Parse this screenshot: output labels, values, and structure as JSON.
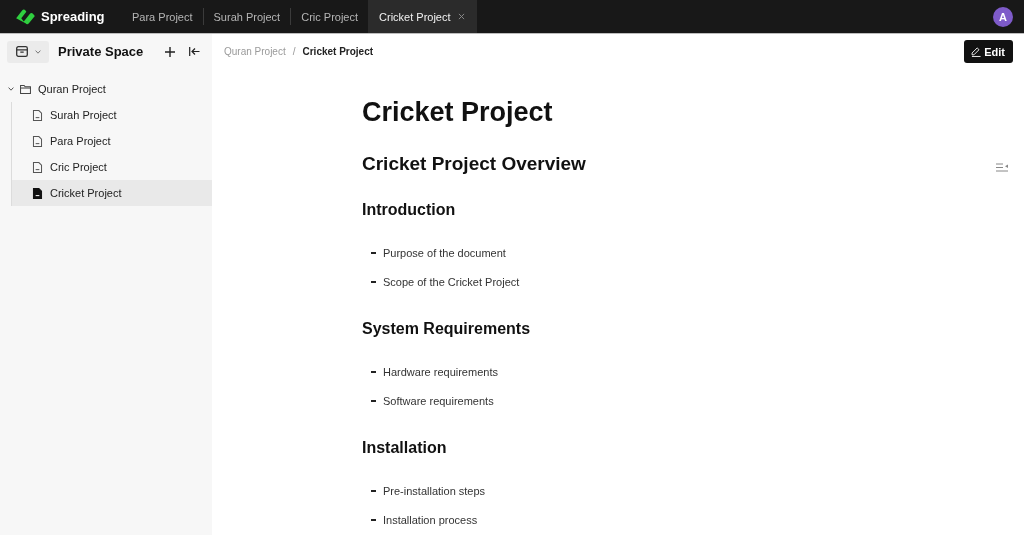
{
  "app_bar": {
    "logo_text": "Spreading",
    "tabs": [
      {
        "label": "Para Project",
        "selected": false
      },
      {
        "label": "Surah Project",
        "selected": false
      },
      {
        "label": "Cric Project",
        "selected": false
      },
      {
        "label": "Cricket Project",
        "selected": true
      }
    ],
    "avatar_initial": "A"
  },
  "sidebar": {
    "title": "Private Space",
    "tree": [
      {
        "label": "Quran Project",
        "kind": "folder",
        "expanded": true,
        "selected": false,
        "children": [
          {
            "label": "Surah Project",
            "kind": "doc",
            "selected": false
          },
          {
            "label": "Para Project",
            "kind": "doc",
            "selected": false
          },
          {
            "label": "Cric Project",
            "kind": "doc",
            "selected": false
          },
          {
            "label": "Cricket Project",
            "kind": "doc",
            "selected": true
          }
        ]
      }
    ]
  },
  "breadcrumb": {
    "items": [
      "Quran Project",
      "Cricket Project"
    ],
    "separator": "/"
  },
  "edit_button": {
    "label": "Edit"
  },
  "document": {
    "title": "Cricket Project",
    "blocks": [
      {
        "kind": "h2",
        "text": "Cricket Project Overview"
      },
      {
        "kind": "h3",
        "text": "Introduction"
      },
      {
        "kind": "bullet",
        "text": "Purpose of the document"
      },
      {
        "kind": "bullet",
        "text": "Scope of the Cricket Project"
      },
      {
        "kind": "h3",
        "text": "System Requirements"
      },
      {
        "kind": "bullet",
        "text": "Hardware requirements"
      },
      {
        "kind": "bullet",
        "text": "Software requirements"
      },
      {
        "kind": "h3",
        "text": "Installation"
      },
      {
        "kind": "bullet",
        "text": "Pre-installation steps"
      },
      {
        "kind": "bullet",
        "text": "Installation process"
      }
    ]
  }
}
